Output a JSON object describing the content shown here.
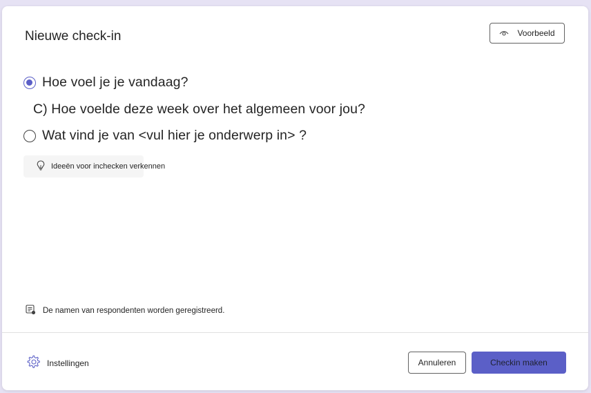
{
  "dialog": {
    "title": "Nieuwe check-in",
    "preview_label": "Voorbeeld"
  },
  "options": [
    {
      "label": "Hoe voel je je vandaag?",
      "selected": true,
      "marker": "radio"
    },
    {
      "label": "C) Hoe voelde deze week over het algemeen voor jou?",
      "selected": false,
      "marker": "none"
    },
    {
      "label": "Wat vind je van <vul hier je onderwerp in> ?",
      "selected": false,
      "marker": "radio"
    }
  ],
  "ideas_button": {
    "label": "Ideeën voor inchecken verkennen",
    "icon": "lightbulb-icon"
  },
  "notice": {
    "text": "De namen van respondenten worden geregistreerd.",
    "icon": "record-list-icon"
  },
  "footer": {
    "settings_label": "Instellingen",
    "cancel_label": "Annuleren",
    "create_label": "Checkin maken"
  },
  "colors": {
    "accent": "#5b5fc7",
    "background": "#e6e2f4",
    "dialog": "#ffffff"
  }
}
